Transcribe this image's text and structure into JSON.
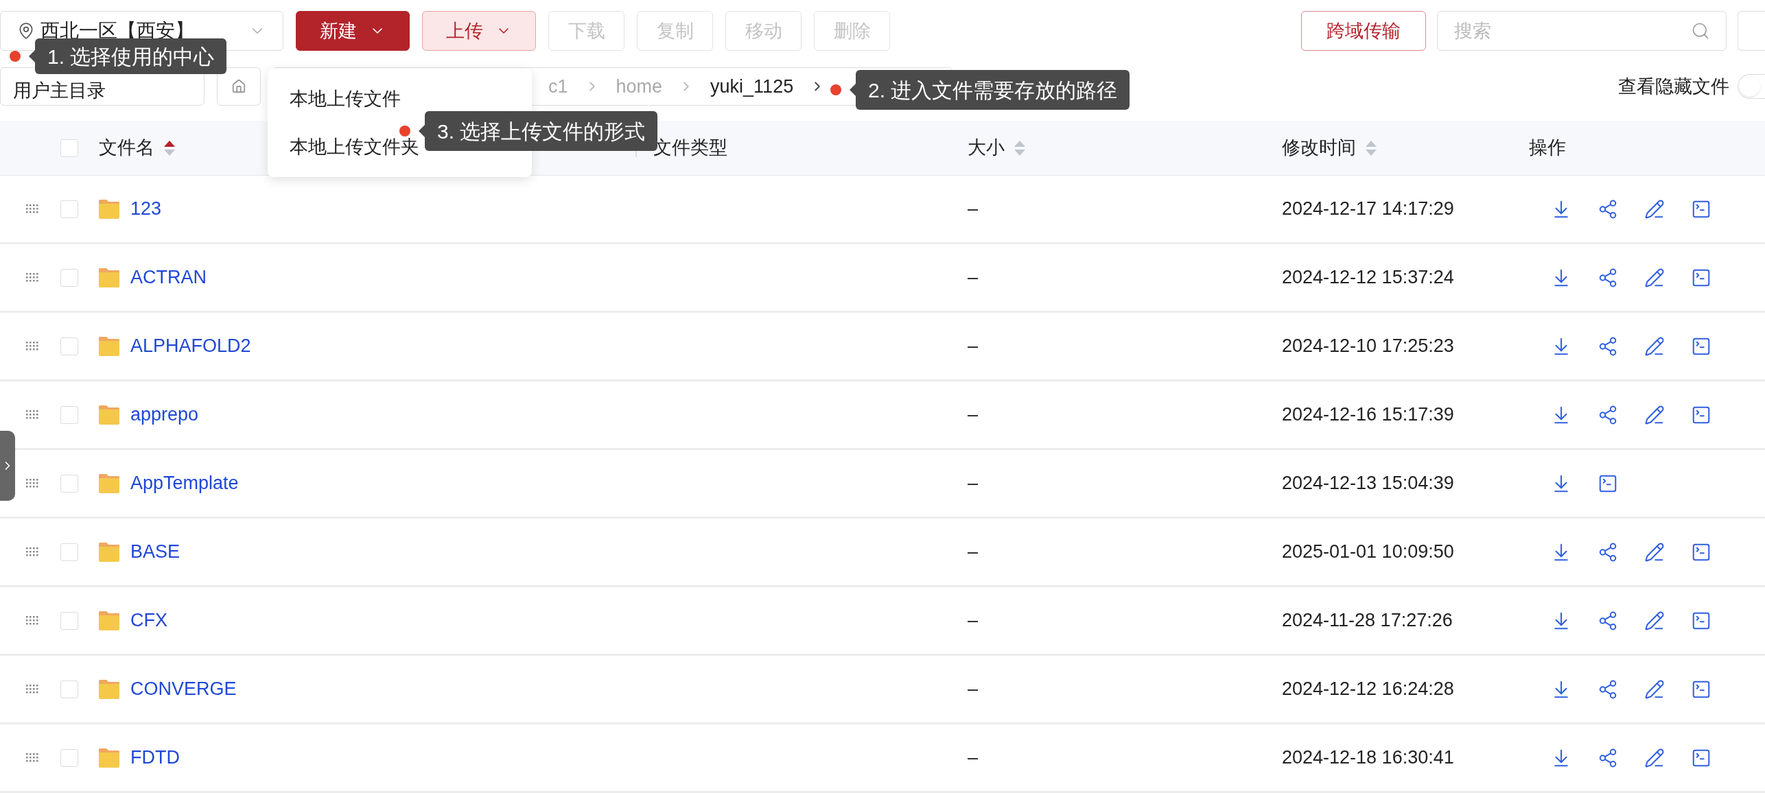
{
  "toolbar": {
    "location": "西北一区【西安】",
    "buttons": [
      {
        "label": "新建",
        "kind": "primary",
        "dropdown": true,
        "disabled": false
      },
      {
        "label": "上传",
        "kind": "open",
        "dropdown": true,
        "disabled": false
      },
      {
        "label": "下载",
        "kind": "plain",
        "dropdown": false,
        "disabled": true
      },
      {
        "label": "复制",
        "kind": "plain",
        "dropdown": false,
        "disabled": true
      },
      {
        "label": "移动",
        "kind": "plain",
        "dropdown": false,
        "disabled": true
      },
      {
        "label": "删除",
        "kind": "plain",
        "dropdown": false,
        "disabled": true
      }
    ],
    "transfer_button": "跨域传输",
    "search": {
      "placeholder": "搜索"
    }
  },
  "path_bar": {
    "root_select": "用户主目录",
    "breadcrumb": [
      "c1",
      "home",
      "yuki_1125"
    ],
    "hidden_files": {
      "label": "查看隐藏文件",
      "on": false
    }
  },
  "upload_menu": [
    {
      "label": "本地上传文件"
    },
    {
      "label": "本地上传文件夹"
    }
  ],
  "tips": [
    "1. 选择使用的中心",
    "2. 进入文件需要存放的路径",
    "3. 选择上传文件的形式"
  ],
  "table": {
    "select_all": {
      "checked": false
    },
    "columns": [
      {
        "label": "文件名",
        "sortable": true,
        "sorted": true
      },
      {
        "label": "文件类型",
        "sortable": false
      },
      {
        "label": "大小",
        "sortable": true,
        "sorted": false
      },
      {
        "label": "修改时间",
        "sortable": true,
        "sorted": false
      },
      {
        "label": "操作",
        "sortable": false
      }
    ],
    "rows": [
      {
        "name": "123",
        "size": "–",
        "modified": "2024-12-17 14:17:29",
        "checked": false,
        "actions": [
          {
            "kind": "download"
          },
          {
            "kind": "share"
          },
          {
            "kind": "edit"
          },
          {
            "kind": "terminal"
          }
        ]
      },
      {
        "name": "ACTRAN",
        "size": "–",
        "modified": "2024-12-12 15:37:24",
        "checked": false,
        "actions": [
          {
            "kind": "download"
          },
          {
            "kind": "share"
          },
          {
            "kind": "edit"
          },
          {
            "kind": "terminal"
          }
        ]
      },
      {
        "name": "ALPHAFOLD2",
        "size": "–",
        "modified": "2024-12-10 17:25:23",
        "checked": false,
        "actions": [
          {
            "kind": "download"
          },
          {
            "kind": "share"
          },
          {
            "kind": "edit"
          },
          {
            "kind": "terminal"
          }
        ]
      },
      {
        "name": "apprepo",
        "size": "–",
        "modified": "2024-12-16 15:17:39",
        "checked": false,
        "actions": [
          {
            "kind": "download"
          },
          {
            "kind": "share"
          },
          {
            "kind": "edit"
          },
          {
            "kind": "terminal"
          }
        ]
      },
      {
        "name": "AppTemplate",
        "size": "–",
        "modified": "2024-12-13 15:04:39",
        "checked": false,
        "actions": [
          {
            "kind": "download"
          },
          {
            "kind": "terminal"
          }
        ]
      },
      {
        "name": "BASE",
        "size": "–",
        "modified": "2025-01-01 10:09:50",
        "checked": false,
        "actions": [
          {
            "kind": "download"
          },
          {
            "kind": "share"
          },
          {
            "kind": "edit"
          },
          {
            "kind": "terminal"
          }
        ]
      },
      {
        "name": "CFX",
        "size": "–",
        "modified": "2024-11-28 17:27:26",
        "checked": false,
        "actions": [
          {
            "kind": "download"
          },
          {
            "kind": "share"
          },
          {
            "kind": "edit"
          },
          {
            "kind": "terminal"
          }
        ]
      },
      {
        "name": "CONVERGE",
        "size": "–",
        "modified": "2024-12-12 16:24:28",
        "checked": false,
        "actions": [
          {
            "kind": "download"
          },
          {
            "kind": "share"
          },
          {
            "kind": "edit"
          },
          {
            "kind": "terminal"
          }
        ]
      },
      {
        "name": "FDTD",
        "size": "–",
        "modified": "2024-12-18 16:30:41",
        "checked": false,
        "actions": [
          {
            "kind": "download"
          },
          {
            "kind": "share"
          },
          {
            "kind": "edit"
          },
          {
            "kind": "terminal"
          }
        ]
      }
    ]
  }
}
